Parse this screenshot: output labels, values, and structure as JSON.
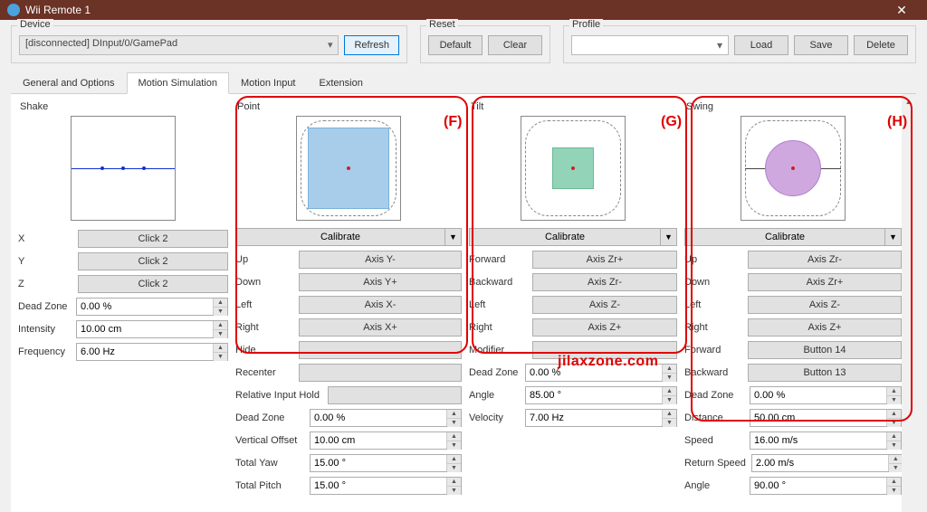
{
  "window": {
    "title": "Wii Remote 1",
    "close": "✕"
  },
  "device": {
    "group_label": "Device",
    "selected": "[disconnected] DInput/0/GamePad",
    "refresh": "Refresh"
  },
  "reset": {
    "group_label": "Reset",
    "default": "Default",
    "clear": "Clear"
  },
  "profile": {
    "group_label": "Profile",
    "load": "Load",
    "save": "Save",
    "delete": "Delete",
    "selected": ""
  },
  "tabs": [
    "General and Options",
    "Motion Simulation",
    "Motion Input",
    "Extension"
  ],
  "calibrate": "Calibrate",
  "shake": {
    "title": "Shake",
    "x_label": "X",
    "x_val": "Click 2",
    "y_label": "Y",
    "y_val": "Click 2",
    "z_label": "Z",
    "z_val": "Click 2",
    "deadzone_label": "Dead Zone",
    "deadzone_val": "0.00 %",
    "intensity_label": "Intensity",
    "intensity_val": "10.00 cm",
    "freq_label": "Frequency",
    "freq_val": "6.00 Hz"
  },
  "point": {
    "title": "Point",
    "up_label": "Up",
    "up_val": "Axis Y-",
    "down_label": "Down",
    "down_val": "Axis Y+",
    "left_label": "Left",
    "left_val": "Axis X-",
    "right_label": "Right",
    "right_val": "Axis X+",
    "hide_label": "Hide",
    "hide_val": "",
    "recenter_label": "Recenter",
    "recenter_val": "",
    "relhold_label": "Relative Input Hold",
    "relhold_val": "",
    "deadzone_label": "Dead Zone",
    "deadzone_val": "0.00 %",
    "voff_label": "Vertical Offset",
    "voff_val": "10.00 cm",
    "yaw_label": "Total Yaw",
    "yaw_val": "15.00 °",
    "pitch_label": "Total Pitch",
    "pitch_val": "15.00 °"
  },
  "tilt": {
    "title": "Tilt",
    "fwd_label": "Forward",
    "fwd_val": "Axis Zr+",
    "bwd_label": "Backward",
    "bwd_val": "Axis Zr-",
    "left_label": "Left",
    "left_val": "Axis Z-",
    "right_label": "Right",
    "right_val": "Axis Z+",
    "mod_label": "Modifier",
    "mod_val": "",
    "deadzone_label": "Dead Zone",
    "deadzone_val": "0.00 %",
    "angle_label": "Angle",
    "angle_val": "85.00 °",
    "vel_label": "Velocity",
    "vel_val": "7.00 Hz"
  },
  "swing": {
    "title": "Swing",
    "up_label": "Up",
    "up_val": "Axis Zr-",
    "down_label": "Down",
    "down_val": "Axis Zr+",
    "left_label": "Left",
    "left_val": "Axis Z-",
    "right_label": "Right",
    "right_val": "Axis Z+",
    "fwd_label": "Forward",
    "fwd_val": "Button 14",
    "bwd_label": "Backward",
    "bwd_val": "Button 13",
    "deadzone_label": "Dead Zone",
    "deadzone_val": "0.00 %",
    "dist_label": "Distance",
    "dist_val": "50.00 cm",
    "speed_label": "Speed",
    "speed_val": "16.00 m/s",
    "retspeed_label": "Return Speed",
    "retspeed_val": "2.00 m/s",
    "angle_label": "Angle",
    "angle_val": "90.00 °"
  },
  "annotations": {
    "f": "(F)",
    "g": "(G)",
    "h": "(H)",
    "watermark": "jilaxzone.com"
  }
}
